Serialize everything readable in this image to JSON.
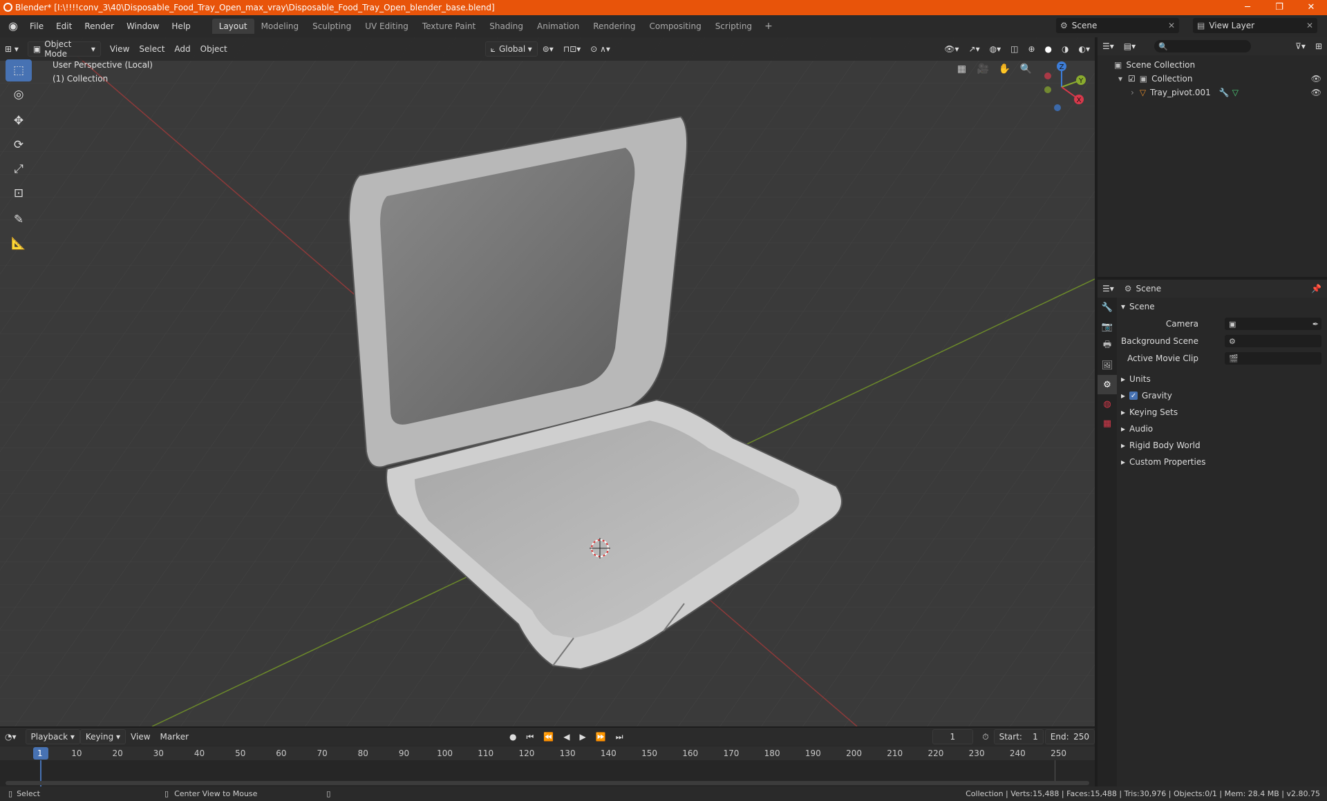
{
  "window": {
    "title": "Blender* [I:\\!!!!conv_3\\40\\Disposable_Food_Tray_Open_max_vray\\Disposable_Food_Tray_Open_blender_base.blend]",
    "minimize": "─",
    "restore": "❐",
    "close": "✕"
  },
  "menu": [
    "File",
    "Edit",
    "Render",
    "Window",
    "Help"
  ],
  "workspaces": [
    "Layout",
    "Modeling",
    "Sculpting",
    "UV Editing",
    "Texture Paint",
    "Shading",
    "Animation",
    "Rendering",
    "Compositing",
    "Scripting"
  ],
  "workspace_add": "+",
  "scene": {
    "name": "Scene",
    "view_layer": "View Layer"
  },
  "viewport": {
    "mode": "Object Mode",
    "menus": [
      "View",
      "Select",
      "Add",
      "Object"
    ],
    "orientation": "Global",
    "perspective": "User Perspective (Local)",
    "collection": "(1) Collection",
    "gizmo": {
      "z": "Z",
      "y": "Y",
      "x": "X"
    }
  },
  "outliner": {
    "root": "Scene Collection",
    "collection": "Collection",
    "object": "Tray_pivot.001",
    "search_placeholder": ""
  },
  "properties": {
    "context": "Scene",
    "panel_title": "Scene",
    "camera_label": "Camera",
    "background_label": "Background Scene",
    "movieclip_label": "Active Movie Clip",
    "sections": [
      "Units",
      "Gravity",
      "Keying Sets",
      "Audio",
      "Rigid Body World",
      "Custom Properties"
    ]
  },
  "timeline": {
    "menus": [
      "Playback",
      "Keying",
      "View",
      "Marker"
    ],
    "current_frame": "1",
    "start_label": "Start:",
    "start": "1",
    "end_label": "End:",
    "end": "250",
    "ticks": [
      "1",
      "10",
      "20",
      "30",
      "40",
      "50",
      "60",
      "70",
      "80",
      "90",
      "100",
      "110",
      "120",
      "130",
      "140",
      "150",
      "160",
      "170",
      "180",
      "190",
      "200",
      "210",
      "220",
      "230",
      "240",
      "250"
    ]
  },
  "status": {
    "select": "Select",
    "center": "Center View to Mouse",
    "stats": "Collection | Verts:15,488 | Faces:15,488 | Tris:30,976 | Objects:0/1 | Mem: 28.4 MB | v2.80.75"
  }
}
